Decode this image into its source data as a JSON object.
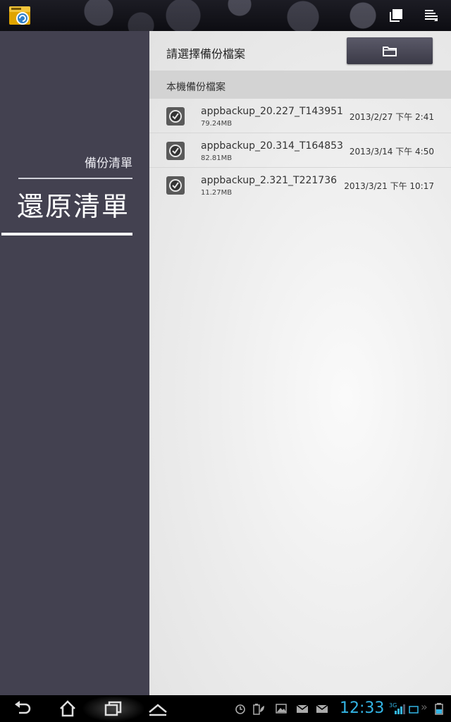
{
  "sidebar": {
    "backup_list": "備份清單",
    "restore_list": "還原清單"
  },
  "header": {
    "choose_label": "請選擇備份檔案"
  },
  "section": {
    "local_label": "本機備份檔案"
  },
  "backups": [
    {
      "name": "appbackup_20.227_T143951",
      "size": "79.24MB",
      "date": "2013/2/27 下午 2:41"
    },
    {
      "name": "appbackup_20.314_T164853",
      "size": "82.81MB",
      "date": "2013/3/14 下午 4:50"
    },
    {
      "name": "appbackup_2.321_T221736",
      "size": "11.27MB",
      "date": "2013/3/21 下午 10:17"
    }
  ],
  "status": {
    "time": "12:33",
    "network": "3G"
  },
  "icons": {
    "app": "app-backup-icon",
    "copy": "stack-icon",
    "menu": "overflow-menu-icon",
    "folder": "folder-icon",
    "row": "backup-clock-icon"
  },
  "colors": {
    "sidebar": "#434150",
    "clock": "#33b5e5"
  }
}
